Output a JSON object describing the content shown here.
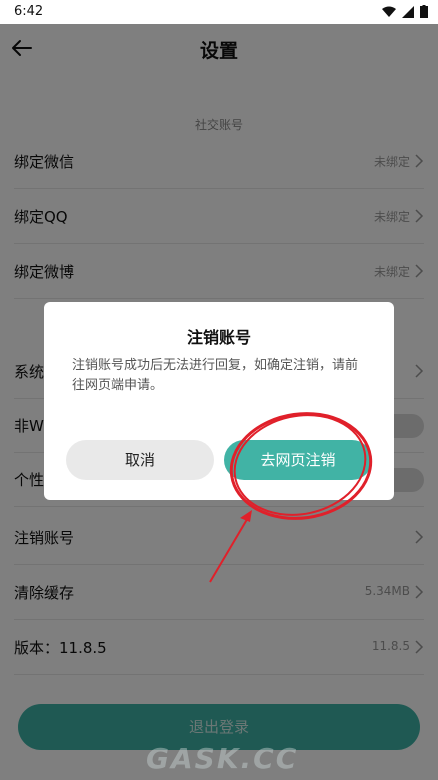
{
  "status_bar": {
    "time": "6:42"
  },
  "header": {
    "title": "设置",
    "back_icon": "arrow-left-icon"
  },
  "social_section": {
    "label": "社交账号",
    "rows": [
      {
        "label": "绑定微信",
        "value": "未绑定"
      },
      {
        "label": "绑定QQ",
        "value": "未绑定"
      },
      {
        "label": "绑定微博",
        "value": "未绑定"
      }
    ]
  },
  "general_rows": [
    {
      "label": "系统"
    },
    {
      "label": "非Wi"
    },
    {
      "label": "个性"
    }
  ],
  "account_rows": [
    {
      "label": "注销账号",
      "value": ""
    },
    {
      "label": "清除缓存",
      "value": "5.34MB"
    },
    {
      "label": "版本：11.8.5",
      "value": "11.8.5"
    }
  ],
  "logout_button": {
    "label": "退出登录"
  },
  "dialog": {
    "title": "注销账号",
    "message": "注销账号成功后无法进行回复，如确定注销，请前往网页端申请。",
    "cancel_label": "取消",
    "confirm_label": "去网页注销"
  },
  "watermark": {
    "text": "GASK.CC"
  },
  "colors": {
    "accent": "#41b3a5",
    "annotation": "#e0202a",
    "overlay": "rgba(0,0,0,0.5)"
  }
}
